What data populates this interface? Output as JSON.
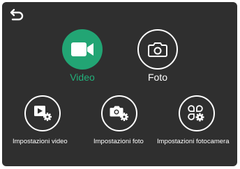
{
  "screen": {
    "back_icon": "back-arrow-icon",
    "colors": {
      "background": "#2f2f2f",
      "accent": "#22a574",
      "foreground": "#ffffff"
    }
  },
  "modes": [
    {
      "label": "Video",
      "icon": "video-camera-icon",
      "active": true
    },
    {
      "label": "Foto",
      "icon": "photo-camera-icon",
      "active": false
    }
  ],
  "settings": [
    {
      "label": "Impostazioni video",
      "icon": "video-settings-icon"
    },
    {
      "label": "Impostazioni foto",
      "icon": "photo-settings-icon"
    },
    {
      "label": "Impostazioni fotocamera",
      "icon": "camera-settings-icon"
    }
  ]
}
